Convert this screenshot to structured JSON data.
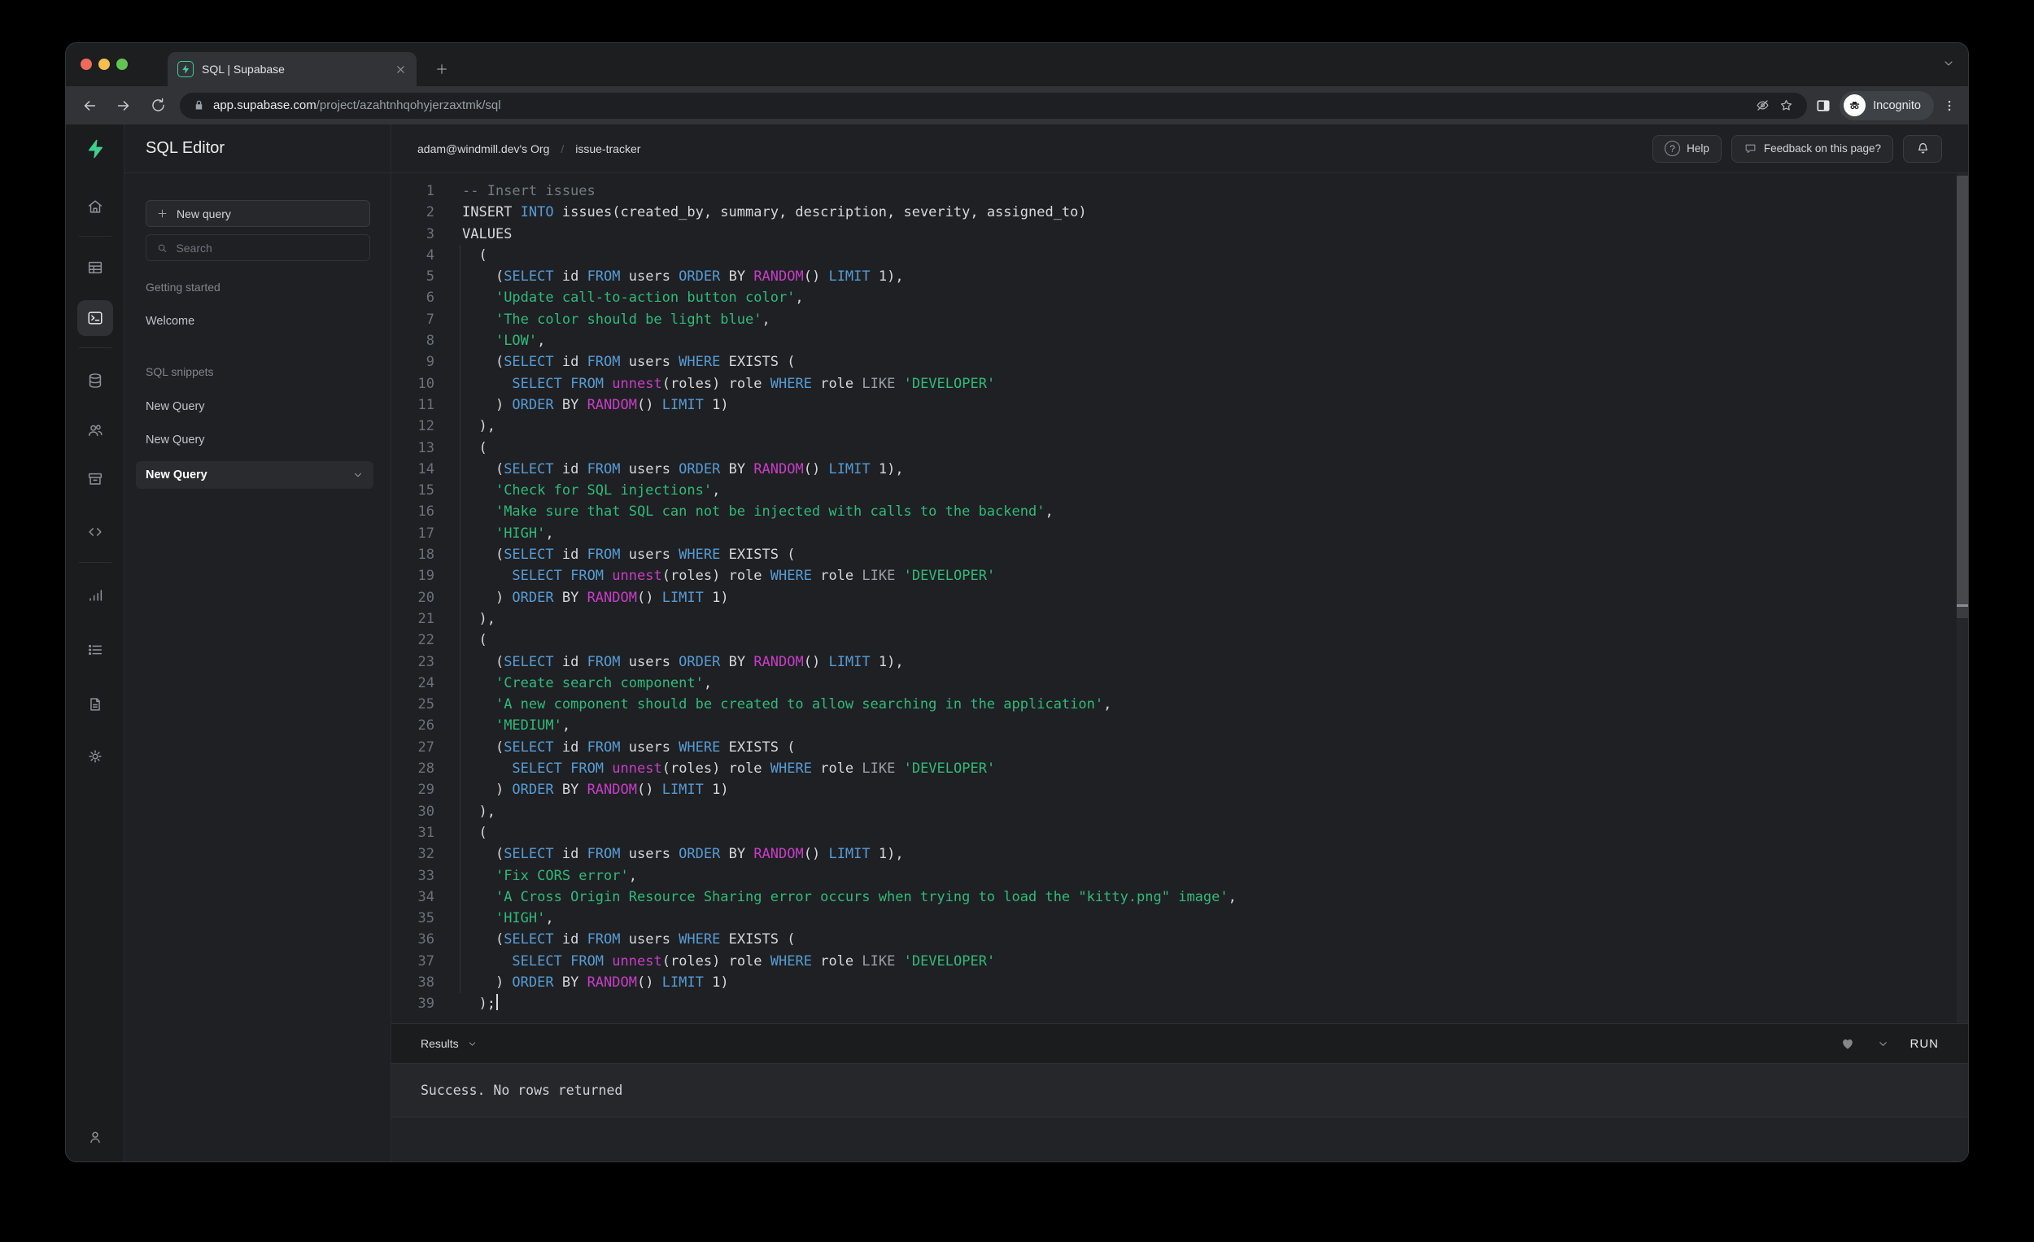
{
  "browser": {
    "tab_title": "SQL | Supabase",
    "url_host": "app.supabase.com",
    "url_path": "/project/azahtnhqohyjerzaxtmk/sql",
    "incognito_label": "Incognito"
  },
  "header": {
    "breadcrumb_org": "adam@windmill.dev's Org",
    "breadcrumb_sep": "/",
    "breadcrumb_project": "issue-tracker",
    "help_label": "Help",
    "feedback_label": "Feedback on this page?"
  },
  "sidebar": {
    "title": "SQL Editor",
    "new_query_label": "New query",
    "search_placeholder": "Search",
    "sections": [
      {
        "label": "Getting started",
        "items": [
          {
            "label": "Welcome"
          }
        ]
      },
      {
        "label": "SQL snippets",
        "items": [
          {
            "label": "New Query"
          },
          {
            "label": "New Query"
          },
          {
            "label": "New Query",
            "active": true
          }
        ]
      }
    ]
  },
  "editor": {
    "lines": [
      {
        "n": 1,
        "t": [
          [
            "c",
            "-- Insert issues"
          ]
        ]
      },
      {
        "n": 2,
        "t": [
          [
            "p",
            "INSERT "
          ],
          [
            "k",
            "INTO"
          ],
          [
            "p",
            " issues(created_by, summary, description, severity, assigned_to)"
          ]
        ]
      },
      {
        "n": 3,
        "t": [
          [
            "p",
            "VALUES"
          ]
        ]
      },
      {
        "n": 4,
        "t": [
          [
            "p",
            "  ("
          ]
        ]
      },
      {
        "n": 5,
        "t": [
          [
            "p",
            "    ("
          ],
          [
            "k",
            "SELECT"
          ],
          [
            "p",
            " id "
          ],
          [
            "k",
            "FROM"
          ],
          [
            "p",
            " users "
          ],
          [
            "k",
            "ORDER"
          ],
          [
            "p",
            " BY "
          ],
          [
            "f",
            "RANDOM"
          ],
          [
            "p",
            "() "
          ],
          [
            "k",
            "LIMIT"
          ],
          [
            "p",
            " 1),"
          ]
        ]
      },
      {
        "n": 6,
        "t": [
          [
            "p",
            "    "
          ],
          [
            "s",
            "'Update call-to-action button color'"
          ],
          [
            "p",
            ","
          ]
        ]
      },
      {
        "n": 7,
        "t": [
          [
            "p",
            "    "
          ],
          [
            "s",
            "'The color should be light blue'"
          ],
          [
            "p",
            ","
          ]
        ]
      },
      {
        "n": 8,
        "t": [
          [
            "p",
            "    "
          ],
          [
            "s",
            "'LOW'"
          ],
          [
            "p",
            ","
          ]
        ]
      },
      {
        "n": 9,
        "t": [
          [
            "p",
            "    ("
          ],
          [
            "k",
            "SELECT"
          ],
          [
            "p",
            " id "
          ],
          [
            "k",
            "FROM"
          ],
          [
            "p",
            " users "
          ],
          [
            "k",
            "WHERE"
          ],
          [
            "p",
            " EXISTS ("
          ]
        ]
      },
      {
        "n": 10,
        "t": [
          [
            "p",
            "      "
          ],
          [
            "k",
            "SELECT"
          ],
          [
            "p",
            " "
          ],
          [
            "k",
            "FROM"
          ],
          [
            "p",
            " "
          ],
          [
            "f",
            "unnest"
          ],
          [
            "p",
            "(roles) role "
          ],
          [
            "k",
            "WHERE"
          ],
          [
            "p",
            " role "
          ],
          [
            "o",
            "LIKE"
          ],
          [
            "p",
            " "
          ],
          [
            "s",
            "'DEVELOPER'"
          ]
        ]
      },
      {
        "n": 11,
        "t": [
          [
            "p",
            "    ) "
          ],
          [
            "k",
            "ORDER"
          ],
          [
            "p",
            " BY "
          ],
          [
            "f",
            "RANDOM"
          ],
          [
            "p",
            "() "
          ],
          [
            "k",
            "LIMIT"
          ],
          [
            "p",
            " 1)"
          ]
        ]
      },
      {
        "n": 12,
        "t": [
          [
            "p",
            "  ),"
          ]
        ]
      },
      {
        "n": 13,
        "t": [
          [
            "p",
            "  ("
          ]
        ]
      },
      {
        "n": 14,
        "t": [
          [
            "p",
            "    ("
          ],
          [
            "k",
            "SELECT"
          ],
          [
            "p",
            " id "
          ],
          [
            "k",
            "FROM"
          ],
          [
            "p",
            " users "
          ],
          [
            "k",
            "ORDER"
          ],
          [
            "p",
            " BY "
          ],
          [
            "f",
            "RANDOM"
          ],
          [
            "p",
            "() "
          ],
          [
            "k",
            "LIMIT"
          ],
          [
            "p",
            " 1),"
          ]
        ]
      },
      {
        "n": 15,
        "t": [
          [
            "p",
            "    "
          ],
          [
            "s",
            "'Check for SQL injections'"
          ],
          [
            "p",
            ","
          ]
        ]
      },
      {
        "n": 16,
        "t": [
          [
            "p",
            "    "
          ],
          [
            "s",
            "'Make sure that SQL can not be injected with calls to the backend'"
          ],
          [
            "p",
            ","
          ]
        ]
      },
      {
        "n": 17,
        "t": [
          [
            "p",
            "    "
          ],
          [
            "s",
            "'HIGH'"
          ],
          [
            "p",
            ","
          ]
        ]
      },
      {
        "n": 18,
        "t": [
          [
            "p",
            "    ("
          ],
          [
            "k",
            "SELECT"
          ],
          [
            "p",
            " id "
          ],
          [
            "k",
            "FROM"
          ],
          [
            "p",
            " users "
          ],
          [
            "k",
            "WHERE"
          ],
          [
            "p",
            " EXISTS ("
          ]
        ]
      },
      {
        "n": 19,
        "t": [
          [
            "p",
            "      "
          ],
          [
            "k",
            "SELECT"
          ],
          [
            "p",
            " "
          ],
          [
            "k",
            "FROM"
          ],
          [
            "p",
            " "
          ],
          [
            "f",
            "unnest"
          ],
          [
            "p",
            "(roles) role "
          ],
          [
            "k",
            "WHERE"
          ],
          [
            "p",
            " role "
          ],
          [
            "o",
            "LIKE"
          ],
          [
            "p",
            " "
          ],
          [
            "s",
            "'DEVELOPER'"
          ]
        ]
      },
      {
        "n": 20,
        "t": [
          [
            "p",
            "    ) "
          ],
          [
            "k",
            "ORDER"
          ],
          [
            "p",
            " BY "
          ],
          [
            "f",
            "RANDOM"
          ],
          [
            "p",
            "() "
          ],
          [
            "k",
            "LIMIT"
          ],
          [
            "p",
            " 1)"
          ]
        ]
      },
      {
        "n": 21,
        "t": [
          [
            "p",
            "  ),"
          ]
        ]
      },
      {
        "n": 22,
        "t": [
          [
            "p",
            "  ("
          ]
        ]
      },
      {
        "n": 23,
        "t": [
          [
            "p",
            "    ("
          ],
          [
            "k",
            "SELECT"
          ],
          [
            "p",
            " id "
          ],
          [
            "k",
            "FROM"
          ],
          [
            "p",
            " users "
          ],
          [
            "k",
            "ORDER"
          ],
          [
            "p",
            " BY "
          ],
          [
            "f",
            "RANDOM"
          ],
          [
            "p",
            "() "
          ],
          [
            "k",
            "LIMIT"
          ],
          [
            "p",
            " 1),"
          ]
        ]
      },
      {
        "n": 24,
        "t": [
          [
            "p",
            "    "
          ],
          [
            "s",
            "'Create search component'"
          ],
          [
            "p",
            ","
          ]
        ]
      },
      {
        "n": 25,
        "t": [
          [
            "p",
            "    "
          ],
          [
            "s",
            "'A new component should be created to allow searching in the application'"
          ],
          [
            "p",
            ","
          ]
        ]
      },
      {
        "n": 26,
        "t": [
          [
            "p",
            "    "
          ],
          [
            "s",
            "'MEDIUM'"
          ],
          [
            "p",
            ","
          ]
        ]
      },
      {
        "n": 27,
        "t": [
          [
            "p",
            "    ("
          ],
          [
            "k",
            "SELECT"
          ],
          [
            "p",
            " id "
          ],
          [
            "k",
            "FROM"
          ],
          [
            "p",
            " users "
          ],
          [
            "k",
            "WHERE"
          ],
          [
            "p",
            " EXISTS ("
          ]
        ]
      },
      {
        "n": 28,
        "t": [
          [
            "p",
            "      "
          ],
          [
            "k",
            "SELECT"
          ],
          [
            "p",
            " "
          ],
          [
            "k",
            "FROM"
          ],
          [
            "p",
            " "
          ],
          [
            "f",
            "unnest"
          ],
          [
            "p",
            "(roles) role "
          ],
          [
            "k",
            "WHERE"
          ],
          [
            "p",
            " role "
          ],
          [
            "o",
            "LIKE"
          ],
          [
            "p",
            " "
          ],
          [
            "s",
            "'DEVELOPER'"
          ]
        ]
      },
      {
        "n": 29,
        "t": [
          [
            "p",
            "    ) "
          ],
          [
            "k",
            "ORDER"
          ],
          [
            "p",
            " BY "
          ],
          [
            "f",
            "RANDOM"
          ],
          [
            "p",
            "() "
          ],
          [
            "k",
            "LIMIT"
          ],
          [
            "p",
            " 1)"
          ]
        ]
      },
      {
        "n": 30,
        "t": [
          [
            "p",
            "  ),"
          ]
        ]
      },
      {
        "n": 31,
        "t": [
          [
            "p",
            "  ("
          ]
        ]
      },
      {
        "n": 32,
        "t": [
          [
            "p",
            "    ("
          ],
          [
            "k",
            "SELECT"
          ],
          [
            "p",
            " id "
          ],
          [
            "k",
            "FROM"
          ],
          [
            "p",
            " users "
          ],
          [
            "k",
            "ORDER"
          ],
          [
            "p",
            " BY "
          ],
          [
            "f",
            "RANDOM"
          ],
          [
            "p",
            "() "
          ],
          [
            "k",
            "LIMIT"
          ],
          [
            "p",
            " 1),"
          ]
        ]
      },
      {
        "n": 33,
        "t": [
          [
            "p",
            "    "
          ],
          [
            "s",
            "'Fix CORS error'"
          ],
          [
            "p",
            ","
          ]
        ]
      },
      {
        "n": 34,
        "t": [
          [
            "p",
            "    "
          ],
          [
            "s",
            "'A Cross Origin Resource Sharing error occurs when trying to load the \"kitty.png\" image'"
          ],
          [
            "p",
            ","
          ]
        ]
      },
      {
        "n": 35,
        "t": [
          [
            "p",
            "    "
          ],
          [
            "s",
            "'HIGH'"
          ],
          [
            "p",
            ","
          ]
        ]
      },
      {
        "n": 36,
        "t": [
          [
            "p",
            "    ("
          ],
          [
            "k",
            "SELECT"
          ],
          [
            "p",
            " id "
          ],
          [
            "k",
            "FROM"
          ],
          [
            "p",
            " users "
          ],
          [
            "k",
            "WHERE"
          ],
          [
            "p",
            " EXISTS ("
          ]
        ]
      },
      {
        "n": 37,
        "t": [
          [
            "p",
            "      "
          ],
          [
            "k",
            "SELECT"
          ],
          [
            "p",
            " "
          ],
          [
            "k",
            "FROM"
          ],
          [
            "p",
            " "
          ],
          [
            "f",
            "unnest"
          ],
          [
            "p",
            "(roles) role "
          ],
          [
            "k",
            "WHERE"
          ],
          [
            "p",
            " role "
          ],
          [
            "o",
            "LIKE"
          ],
          [
            "p",
            " "
          ],
          [
            "s",
            "'DEVELOPER'"
          ]
        ]
      },
      {
        "n": 38,
        "t": [
          [
            "p",
            "    ) "
          ],
          [
            "k",
            "ORDER"
          ],
          [
            "p",
            " BY "
          ],
          [
            "f",
            "RANDOM"
          ],
          [
            "p",
            "() "
          ],
          [
            "k",
            "LIMIT"
          ],
          [
            "p",
            " 1)"
          ]
        ]
      },
      {
        "n": 39,
        "t": [
          [
            "p",
            "  );"
          ]
        ],
        "cursor": true
      }
    ]
  },
  "results": {
    "label": "Results",
    "run_label": "RUN",
    "message": "Success. No rows returned"
  },
  "theme": {
    "brand_green": "#3ECF8E",
    "keyword_blue": "#569CD6",
    "function_magenta": "#C73EC7",
    "string_green": "#2FBA7D",
    "comment_gray": "#747B85",
    "editor_background": "#1F2023",
    "traffic_red": "#EE6A5F",
    "traffic_yellow": "#F5BF4F",
    "traffic_green": "#61C454"
  },
  "icons": {
    "rail": [
      "supabase-logo",
      "home-icon",
      "table-editor-icon",
      "sql-editor-terminal-icon",
      "database-icon",
      "auth-users-icon",
      "storage-archive-icon",
      "api-code-icon",
      "reports-chart-icon",
      "logs-list-icon",
      "docs-file-icon",
      "settings-gear-icon",
      "account-person-icon"
    ],
    "browser": [
      "back-icon",
      "forward-icon",
      "reload-icon",
      "lock-icon",
      "eye-off-icon",
      "star-icon",
      "side-panel-icon",
      "incognito-spy-icon",
      "menu-dots-icon",
      "close-icon",
      "plus-icon",
      "chevron-down-icon"
    ],
    "results_bar": [
      "heart-icon",
      "chevron-down-icon"
    ]
  }
}
